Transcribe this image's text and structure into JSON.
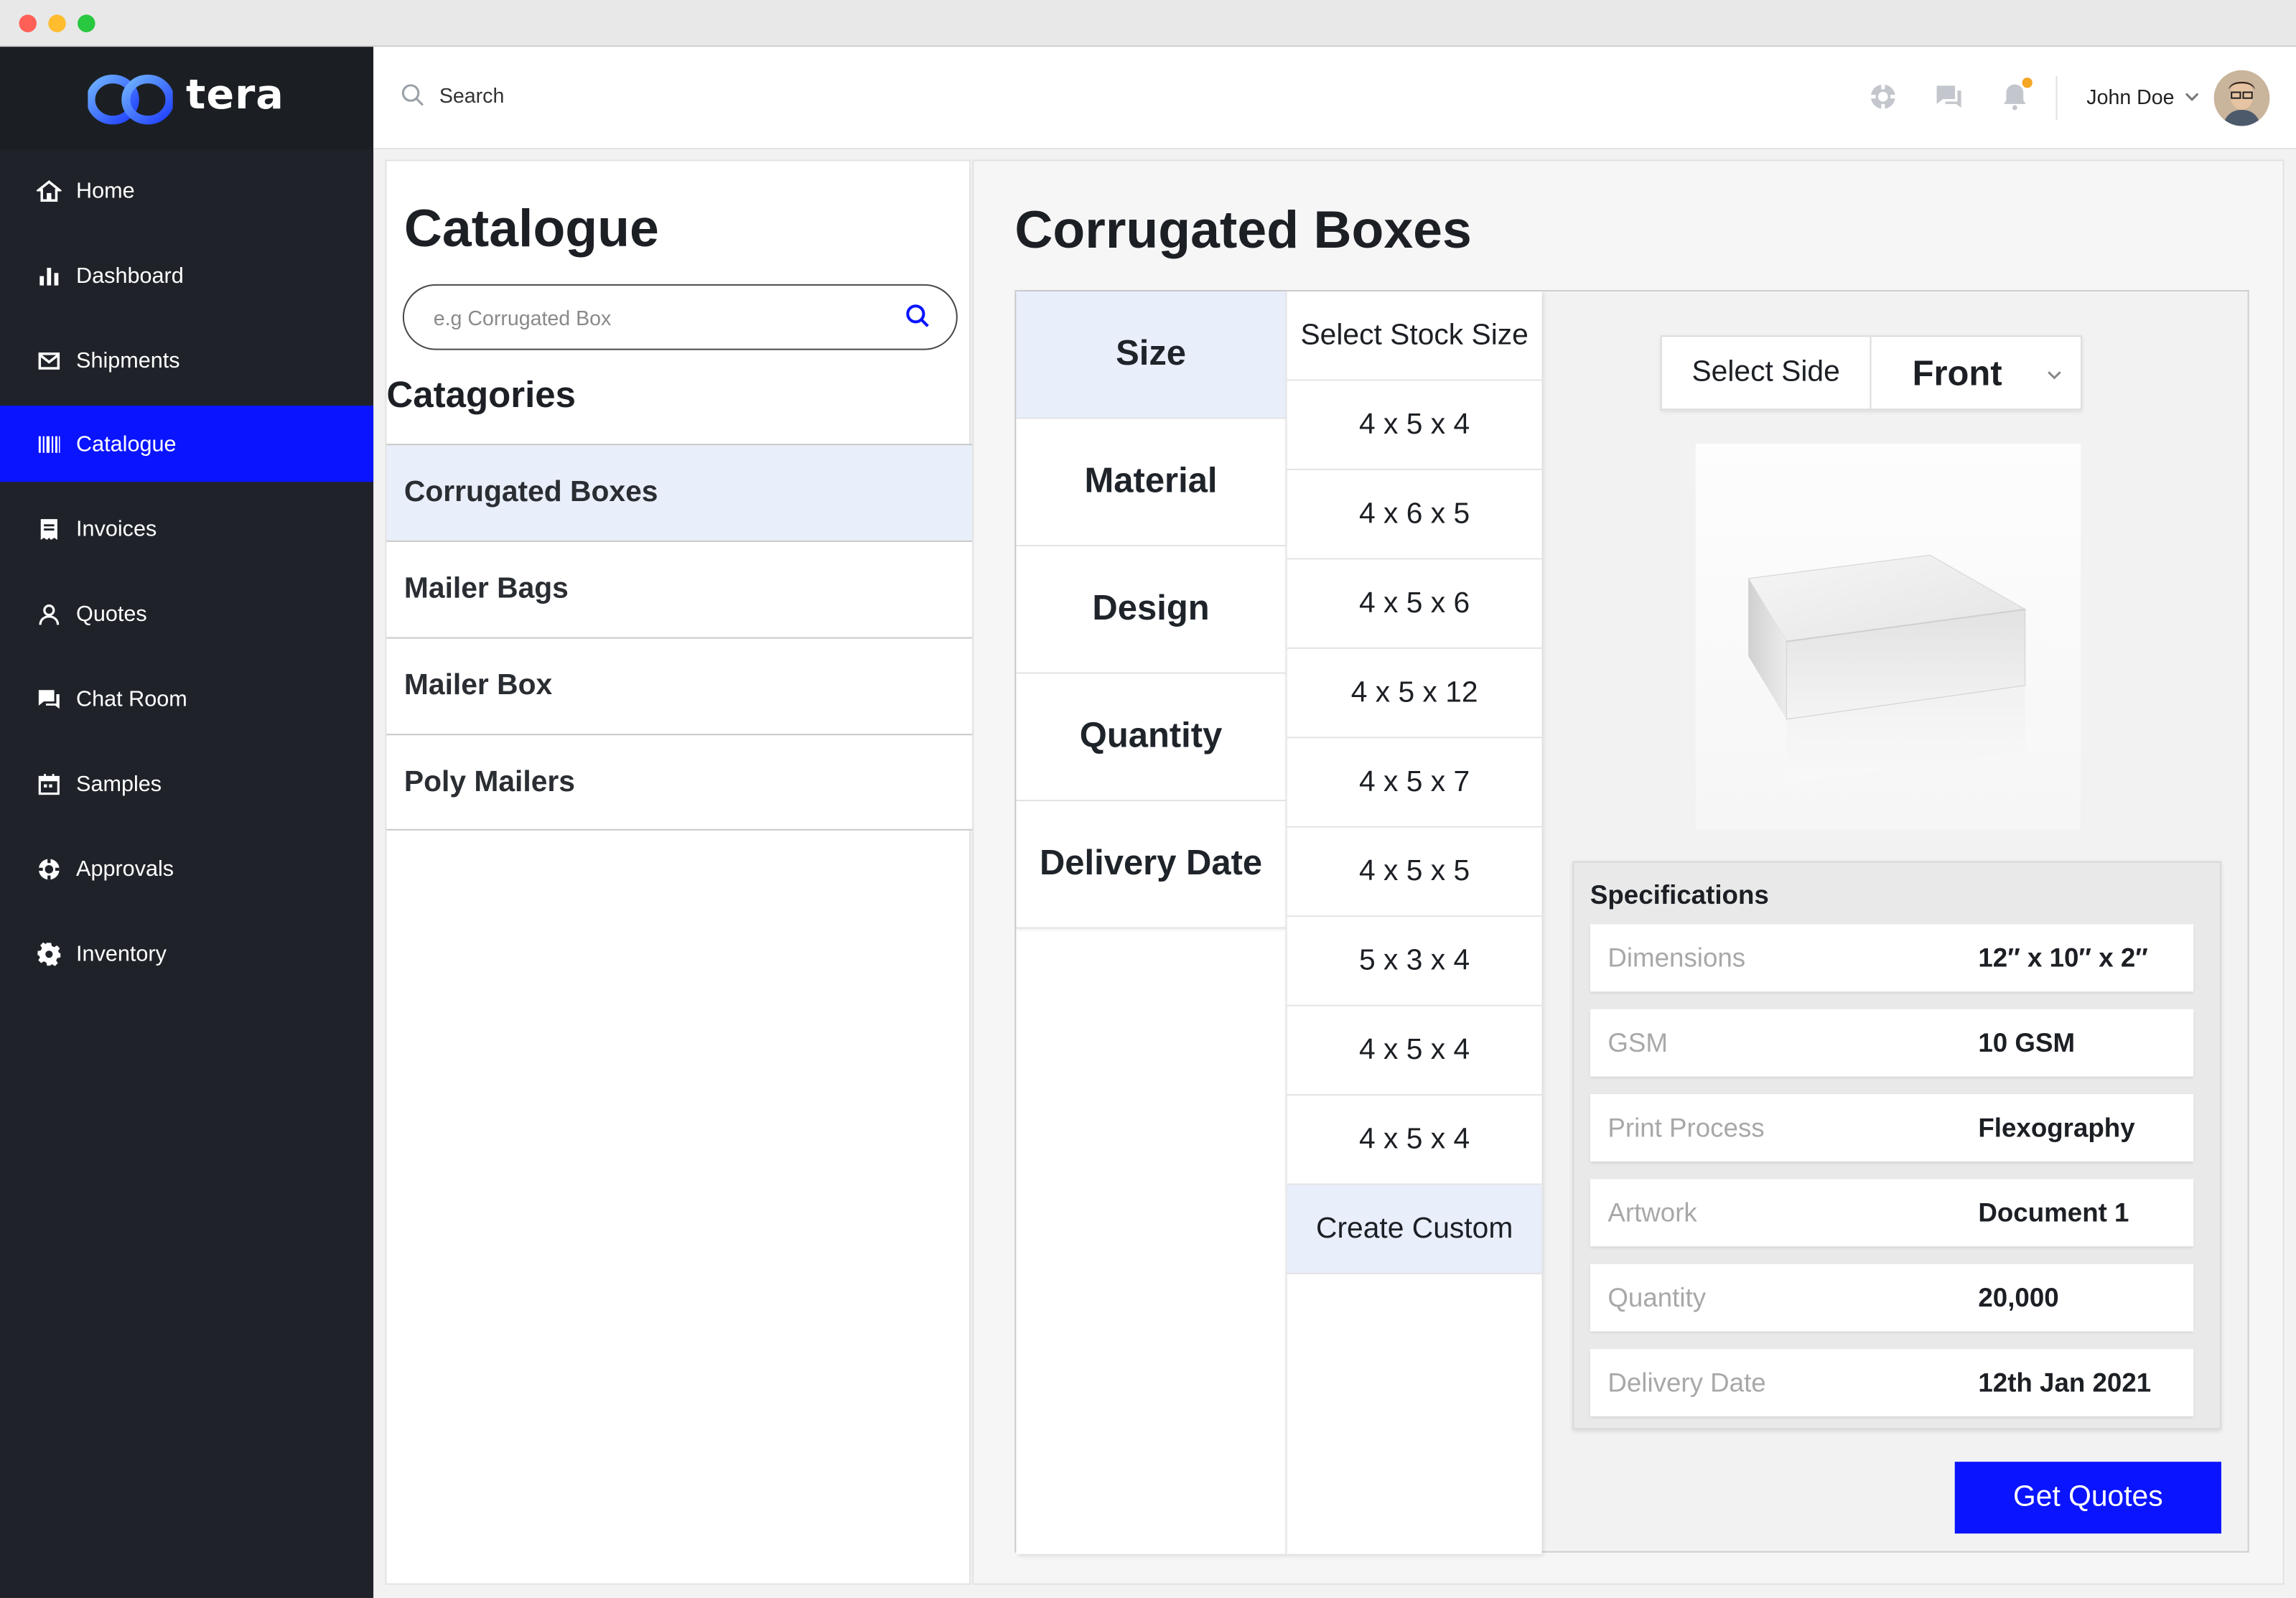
{
  "app": {
    "logo_text": "tera"
  },
  "sidebar": {
    "items": [
      {
        "label": "Home",
        "icon": "home-icon"
      },
      {
        "label": "Dashboard",
        "icon": "bar-chart-icon"
      },
      {
        "label": "Shipments",
        "icon": "mail-icon"
      },
      {
        "label": "Catalogue",
        "icon": "barcode-icon",
        "active": true
      },
      {
        "label": "Invoices",
        "icon": "invoice-icon"
      },
      {
        "label": "Quotes",
        "icon": "user-icon"
      },
      {
        "label": "Chat Room",
        "icon": "chat-icon"
      },
      {
        "label": "Samples",
        "icon": "calendar-icon"
      },
      {
        "label": "Approvals",
        "icon": "lifebuoy-icon"
      },
      {
        "label": "Inventory",
        "icon": "gear-icon"
      }
    ]
  },
  "topbar": {
    "search_label": "Search",
    "user_name": "John Doe",
    "icons": [
      "support-icon",
      "chat-icon",
      "bell-icon"
    ]
  },
  "catalogue": {
    "title": "Catalogue",
    "search_placeholder": "e.g Corrugated Box",
    "categories_title": "Catagories",
    "categories": [
      "Corrugated Boxes",
      "Mailer Bags",
      "Mailer Box",
      "Poly Mailers"
    ]
  },
  "product": {
    "title": "Corrugated Boxes",
    "options": [
      "Size",
      "Material",
      "Design",
      "Quantity",
      "Delivery Date"
    ],
    "size_header": "Select Stock Size",
    "sizes": [
      "4 x 5 x 4",
      "4 x 6 x 5",
      "4 x 5 x 6",
      "4 x 5 x 12",
      "4 x 5 x 7",
      "4 x 5 x 5",
      "5 x 3 x 4",
      "4 x 5 x 4",
      "4 x 5 x 4"
    ],
    "custom_label": "Create Custom",
    "side_label": "Select Side",
    "side_value": "Front",
    "specs_title": "Specifications",
    "specs": [
      {
        "key": "Dimensions",
        "value": "12″ x 10″ x 2″"
      },
      {
        "key": "GSM",
        "value": "10 GSM"
      },
      {
        "key": "Print Process",
        "value": "Flexography"
      },
      {
        "key": "Artwork",
        "value": "Document 1"
      },
      {
        "key": "Quantity",
        "value": "20,000"
      },
      {
        "key": "Delivery Date",
        "value": "12th Jan 2021"
      }
    ],
    "quote_button": "Get Quotes"
  },
  "colors": {
    "accent": "#0a14ff",
    "sidebar_bg": "#1f2329",
    "selected_bg": "#e9eefb",
    "notification": "#f5a623"
  }
}
